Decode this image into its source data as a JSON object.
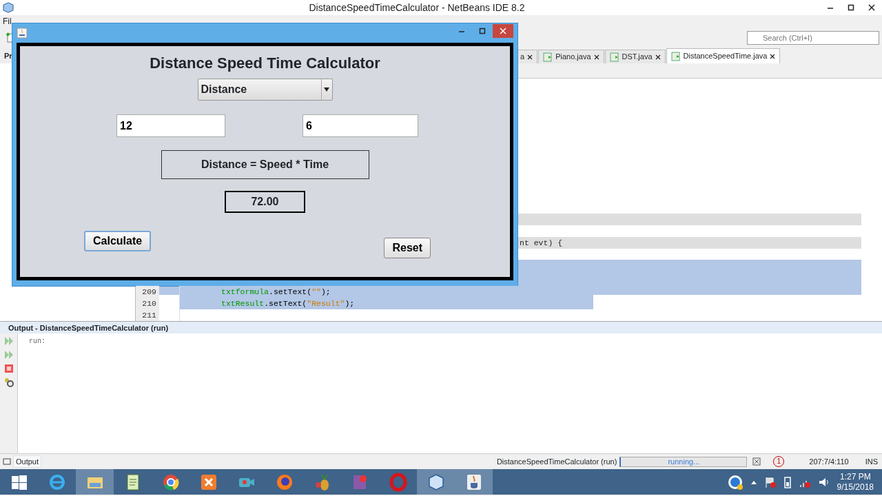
{
  "window": {
    "title": "DistanceSpeedTimeCalculator - NetBeans IDE 8.2"
  },
  "search": {
    "placeholder": "Search (Ctrl+I)"
  },
  "menu": [
    "Fil"
  ],
  "projects": {
    "tab": "Pr"
  },
  "editor_tabs": [
    {
      "label": "a",
      "selected": false
    },
    {
      "label": "Piano.java",
      "selected": false
    },
    {
      "label": "DST.java",
      "selected": false
    },
    {
      "label": "DistanceSpeedTime.java",
      "selected": true
    }
  ],
  "code": {
    "partial_line": "nt evt) {",
    "lines": [
      {
        "number": "209",
        "selected": true,
        "parts": [
          {
            "text": "txtformula",
            "kind": "field"
          },
          {
            "text": ".setText(",
            "kind": "plain"
          },
          {
            "text": "\"\"",
            "kind": "string"
          },
          {
            "text": ");",
            "kind": "plain"
          }
        ]
      },
      {
        "number": "210",
        "selected": true,
        "parts": [
          {
            "text": "txtResult",
            "kind": "field"
          },
          {
            "text": ".setText(",
            "kind": "plain"
          },
          {
            "text": "\"Result\"",
            "kind": "string"
          },
          {
            "text": ");",
            "kind": "plain"
          }
        ]
      },
      {
        "number": "211"
      }
    ]
  },
  "output": {
    "title": "Output - DistanceSpeedTimeCalculator (run)",
    "text": "run:",
    "tab": "Output"
  },
  "status_bar": {
    "task": "DistanceSpeedTimeCalculator (run)",
    "progress": {
      "text": "running...",
      "level": 1
    },
    "notifications": "1",
    "position": "207:7/4:110",
    "mode": "INS"
  },
  "dialog": {
    "heading": "Distance Speed Time Calculator",
    "mode": "Distance",
    "first_value": "12",
    "second_value": "6",
    "formula": "Distance = Speed * Time",
    "result": "72.00",
    "buttons": [
      {
        "label": "Calculate",
        "focused": true
      },
      {
        "label": "Reset",
        "focused": false
      }
    ]
  },
  "taskbar": {
    "apps": [
      {
        "kind": "start",
        "active": false
      },
      {
        "kind": "ie",
        "active": false
      },
      {
        "kind": "explorer",
        "active": true
      },
      {
        "kind": "notepad",
        "active": false
      },
      {
        "kind": "chrome",
        "active": false
      },
      {
        "kind": "xampp",
        "active": false
      },
      {
        "kind": "camera",
        "active": false
      },
      {
        "kind": "firefox",
        "active": false
      },
      {
        "kind": "fruit",
        "active": false
      },
      {
        "kind": "app4",
        "active": false
      },
      {
        "kind": "opera",
        "active": false
      },
      {
        "kind": "netbeans",
        "active": true
      },
      {
        "kind": "java",
        "active": true
      }
    ],
    "time": "1:27 PM",
    "date": "9/15/2018"
  }
}
